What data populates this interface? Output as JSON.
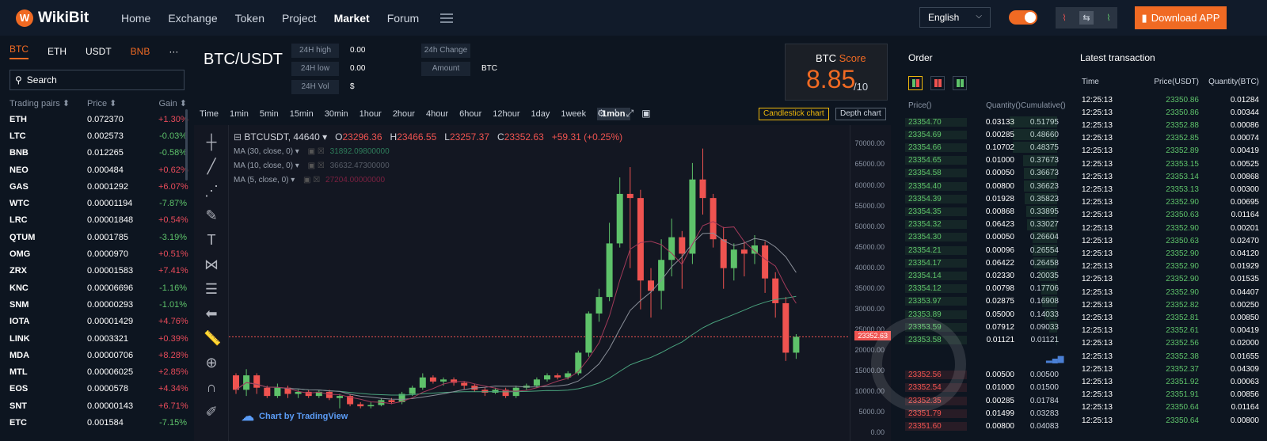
{
  "header": {
    "brand": "WikiBit",
    "nav": [
      "Home",
      "Exchange",
      "Token",
      "Project",
      "Market",
      "Forum"
    ],
    "active_nav": "Market",
    "language": "English",
    "download": "Download APP"
  },
  "left": {
    "tabs": [
      "BTC",
      "ETH",
      "USDT",
      "BNB",
      "···"
    ],
    "selected_tab": "BTC",
    "search_placeholder": "Search",
    "columns": [
      "Trading pairs",
      "Price",
      "Gain"
    ],
    "rows": [
      {
        "pair": "ETH",
        "price": "0.072370",
        "gain": "+1.30%"
      },
      {
        "pair": "LTC",
        "price": "0.002573",
        "gain": "-0.03%"
      },
      {
        "pair": "BNB",
        "price": "0.012265",
        "gain": "-0.58%"
      },
      {
        "pair": "NEO",
        "price": "0.000484",
        "gain": "+0.62%"
      },
      {
        "pair": "GAS",
        "price": "0.0001292",
        "gain": "+6.07%"
      },
      {
        "pair": "WTC",
        "price": "0.00001194",
        "gain": "-7.87%"
      },
      {
        "pair": "LRC",
        "price": "0.00001848",
        "gain": "+0.54%"
      },
      {
        "pair": "QTUM",
        "price": "0.0001785",
        "gain": "-3.19%"
      },
      {
        "pair": "OMG",
        "price": "0.0000970",
        "gain": "+0.51%"
      },
      {
        "pair": "ZRX",
        "price": "0.00001583",
        "gain": "+7.41%"
      },
      {
        "pair": "KNC",
        "price": "0.00006696",
        "gain": "-1.16%"
      },
      {
        "pair": "SNM",
        "price": "0.00000293",
        "gain": "-1.01%"
      },
      {
        "pair": "IOTA",
        "price": "0.00001429",
        "gain": "+4.76%"
      },
      {
        "pair": "LINK",
        "price": "0.0003321",
        "gain": "+0.39%"
      },
      {
        "pair": "MDA",
        "price": "0.00000706",
        "gain": "+8.28%"
      },
      {
        "pair": "MTL",
        "price": "0.00006025",
        "gain": "+2.85%"
      },
      {
        "pair": "EOS",
        "price": "0.0000578",
        "gain": "+4.34%"
      },
      {
        "pair": "SNT",
        "price": "0.00000143",
        "gain": "+6.71%"
      },
      {
        "pair": "ETC",
        "price": "0.001584",
        "gain": "-7.15%"
      }
    ]
  },
  "market": {
    "pair": "BTC/USDT",
    "stats": {
      "h24_label": "24H high",
      "h24": "0.00",
      "l24_label": "24H low",
      "l24": "0.00",
      "vol_label": "24H Vol",
      "vol": "$",
      "chg_label": "24h Change",
      "amount_label": "Amount",
      "amount_unit": "BTC"
    },
    "score": {
      "coin": "BTC",
      "label": "Score",
      "value": "8.85",
      "max": "/10"
    },
    "intervals": [
      "Time",
      "1min",
      "5min",
      "15min",
      "30min",
      "1hour",
      "2hour",
      "4hour",
      "6hour",
      "12hour",
      "1day",
      "1week",
      "1mon"
    ],
    "active_interval": "1mon",
    "candlestick_chart": "Candlestick chart",
    "depth_chart": "Depth chart",
    "symbol": "BTCUSDT, 44640",
    "ohlc": {
      "o": "23296.36",
      "h": "23466.55",
      "l": "23257.37",
      "c": "23352.63",
      "chg": "+59.31 (+0.25%)"
    },
    "ma": [
      {
        "label": "MA (30, close, 0)",
        "value": "31892.09800000"
      },
      {
        "label": "MA (10, close, 0)",
        "value": "36632.47300000"
      },
      {
        "label": "MA (5, close, 0)",
        "value": "27204.00000000"
      }
    ],
    "last_price": "23352.63",
    "tv": "Chart by TradingView",
    "yticks": [
      "70000.00",
      "65000.00",
      "60000.00",
      "55000.00",
      "50000.00",
      "45000.00",
      "40000.00",
      "35000.00",
      "30000.00",
      "25000.00",
      "20000.00",
      "15000.00",
      "10000.00",
      "5000.00",
      "0.00"
    ]
  },
  "chart_data": {
    "type": "candlestick",
    "symbol": "BTCUSDT",
    "ylim": [
      0,
      72000
    ],
    "candles": [
      [
        14000,
        10500,
        14500,
        9500
      ],
      [
        10500,
        14000,
        15500,
        9000
      ],
      [
        14000,
        11000,
        14500,
        9500
      ],
      [
        11000,
        9000,
        11500,
        8500
      ],
      [
        9000,
        11000,
        12000,
        8500
      ],
      [
        11000,
        9500,
        11500,
        8500
      ],
      [
        9500,
        10000,
        10500,
        8500
      ],
      [
        10000,
        9000,
        10500,
        8500
      ],
      [
        9000,
        10000,
        10500,
        8500
      ],
      [
        10000,
        8500,
        10500,
        8000
      ],
      [
        8500,
        9000,
        9500,
        6000
      ],
      [
        9000,
        7000,
        9500,
        6500
      ],
      [
        7000,
        6500,
        7500,
        6000
      ],
      [
        6500,
        6800,
        7500,
        6000
      ],
      [
        6800,
        8000,
        8500,
        6500
      ],
      [
        8000,
        7500,
        8500,
        7000
      ],
      [
        7500,
        9500,
        10000,
        7000
      ],
      [
        9500,
        11000,
        11500,
        9000
      ],
      [
        11000,
        13500,
        14500,
        10500
      ],
      [
        13500,
        12500,
        14000,
        12000
      ],
      [
        12500,
        13000,
        13500,
        11500
      ],
      [
        13000,
        12200,
        13500,
        11500
      ],
      [
        12200,
        11500,
        12500,
        10500
      ],
      [
        11500,
        10500,
        12000,
        10000
      ],
      [
        10500,
        9800,
        11000,
        9000
      ],
      [
        9800,
        10500,
        11000,
        9500
      ],
      [
        10500,
        9000,
        11000,
        8500
      ],
      [
        9000,
        11000,
        11500,
        8500
      ],
      [
        11000,
        11500,
        12000,
        10500
      ],
      [
        11500,
        13000,
        13500,
        11000
      ],
      [
        13000,
        14000,
        14500,
        12500
      ],
      [
        14000,
        13500,
        14500,
        13000
      ],
      [
        13500,
        14500,
        15000,
        13000
      ],
      [
        14500,
        19500,
        20000,
        14000
      ],
      [
        19500,
        29000,
        29500,
        18500
      ],
      [
        29000,
        33000,
        35000,
        27000
      ],
      [
        33000,
        46000,
        51000,
        32000
      ],
      [
        46000,
        58000,
        62000,
        45000
      ],
      [
        58000,
        57000,
        64500,
        40000
      ],
      [
        57000,
        37000,
        59000,
        30000
      ],
      [
        37000,
        34500,
        40000,
        28000
      ],
      [
        34500,
        42000,
        47000,
        30000
      ],
      [
        42000,
        47500,
        52000,
        38000
      ],
      [
        47500,
        43500,
        49000,
        35000
      ],
      [
        43500,
        61500,
        65500,
        41000
      ],
      [
        61500,
        57000,
        69000,
        53000
      ],
      [
        57000,
        47000,
        58000,
        45000
      ],
      [
        47000,
        40000,
        50000,
        35000
      ],
      [
        40000,
        44500,
        46000,
        37000
      ],
      [
        44500,
        43500,
        46500,
        38000
      ],
      [
        43500,
        45500,
        48000,
        41000
      ],
      [
        45500,
        37500,
        46500,
        34000
      ],
      [
        37500,
        31500,
        39000,
        28000
      ],
      [
        31500,
        19500,
        33000,
        17500
      ],
      [
        19500,
        23352,
        24000,
        18000
      ]
    ],
    "ma_series": [
      {
        "name": "MA (30, close, 0)",
        "last": 31892.098
      },
      {
        "name": "MA (10, close, 0)",
        "last": 36632.473
      },
      {
        "name": "MA (5, close, 0)",
        "last": 27204
      }
    ]
  },
  "order": {
    "title": "Order",
    "columns": [
      "Price()",
      "Quantity()",
      "Cumulative()"
    ],
    "asks": [
      [
        "23354.70",
        "0.03133",
        "0.51795"
      ],
      [
        "23354.69",
        "0.00285",
        "0.48660"
      ],
      [
        "23354.66",
        "0.10702",
        "0.48375"
      ],
      [
        "23354.65",
        "0.01000",
        "0.37673"
      ],
      [
        "23354.58",
        "0.00050",
        "0.36673"
      ],
      [
        "23354.40",
        "0.00800",
        "0.36623"
      ],
      [
        "23354.39",
        "0.01928",
        "0.35823"
      ],
      [
        "23354.35",
        "0.00868",
        "0.33895"
      ],
      [
        "23354.32",
        "0.06423",
        "0.33027"
      ],
      [
        "23354.30",
        "0.00050",
        "0.26604"
      ],
      [
        "23354.21",
        "0.00096",
        "0.26554"
      ],
      [
        "23354.17",
        "0.06422",
        "0.26458"
      ],
      [
        "23354.14",
        "0.02330",
        "0.20035"
      ],
      [
        "23354.12",
        "0.00798",
        "0.17706"
      ],
      [
        "23353.97",
        "0.02875",
        "0.16908"
      ],
      [
        "23353.89",
        "0.05000",
        "0.14033"
      ],
      [
        "23353.59",
        "0.07912",
        "0.09033"
      ],
      [
        "23353.58",
        "0.01121",
        "0.01121"
      ]
    ],
    "bids": [
      [
        "23352.56",
        "0.00500",
        "0.00500"
      ],
      [
        "23352.54",
        "0.01000",
        "0.01500"
      ],
      [
        "23352.35",
        "0.00285",
        "0.01784"
      ],
      [
        "23351.79",
        "0.01499",
        "0.03283"
      ],
      [
        "23351.60",
        "0.00800",
        "0.04083"
      ]
    ]
  },
  "latest": {
    "title": "Latest transaction",
    "columns": [
      "Time",
      "Price(USDT)",
      "Quantity(BTC)"
    ],
    "rows": [
      [
        "12:25:13",
        "23350.86",
        "0.01284"
      ],
      [
        "12:25:13",
        "23350.86",
        "0.00344"
      ],
      [
        "12:25:13",
        "23352.88",
        "0.00086"
      ],
      [
        "12:25:13",
        "23352.85",
        "0.00074"
      ],
      [
        "12:25:13",
        "23352.89",
        "0.00419"
      ],
      [
        "12:25:13",
        "23353.15",
        "0.00525"
      ],
      [
        "12:25:13",
        "23353.14",
        "0.00868"
      ],
      [
        "12:25:13",
        "23353.13",
        "0.00300"
      ],
      [
        "12:25:13",
        "23352.90",
        "0.00695"
      ],
      [
        "12:25:13",
        "23350.63",
        "0.01164"
      ],
      [
        "12:25:13",
        "23352.90",
        "0.00201"
      ],
      [
        "12:25:13",
        "23350.63",
        "0.02470"
      ],
      [
        "12:25:13",
        "23352.90",
        "0.04120"
      ],
      [
        "12:25:13",
        "23352.90",
        "0.01929"
      ],
      [
        "12:25:13",
        "23352.90",
        "0.01535"
      ],
      [
        "12:25:13",
        "23352.90",
        "0.04407"
      ],
      [
        "12:25:13",
        "23352.82",
        "0.00250"
      ],
      [
        "12:25:13",
        "23352.81",
        "0.00850"
      ],
      [
        "12:25:13",
        "23352.61",
        "0.00419"
      ],
      [
        "12:25:13",
        "23352.56",
        "0.02000"
      ],
      [
        "12:25:13",
        "23352.38",
        "0.01655"
      ],
      [
        "12:25:13",
        "23352.37",
        "0.04309"
      ],
      [
        "12:25:13",
        "23351.92",
        "0.00063"
      ],
      [
        "12:25:13",
        "23351.91",
        "0.00856"
      ],
      [
        "12:25:13",
        "23350.64",
        "0.01164"
      ],
      [
        "12:25:13",
        "23350.64",
        "0.00800"
      ]
    ]
  },
  "colors": {
    "accent": "#f06a23",
    "up": "#ef5350",
    "down": "#5ec26a",
    "ask_text": "#5ec26a",
    "bid_text": "#ef5350"
  }
}
